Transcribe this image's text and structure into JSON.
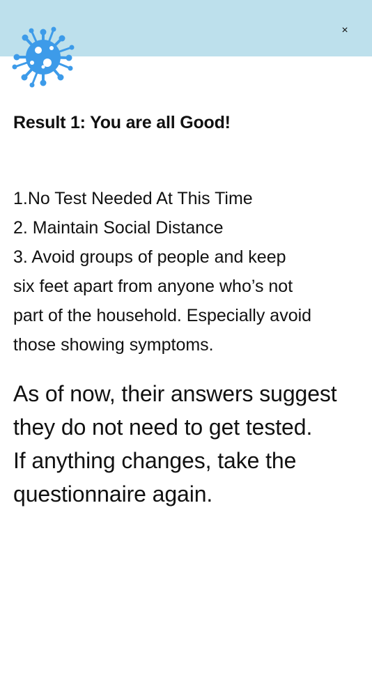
{
  "header": {
    "background": "#bde0ec",
    "close_label": "×",
    "logo_icon": "virus-icon",
    "logo_color": "#3d9be9"
  },
  "result": {
    "title": "Result 1: You are all Good!"
  },
  "instructions": [
    "1.No Test Needed At This Time",
    "2. Maintain Social Distance",
    "3. Avoid groups of people and keep",
    "six feet apart from anyone who’s not",
    "part of the household. Especially avoid",
    "those showing symptoms."
  ],
  "summary": [
    "As of now, their answers suggest",
    "they do not need to get tested.",
    "If anything changes, take the",
    "questionnaire again."
  ]
}
